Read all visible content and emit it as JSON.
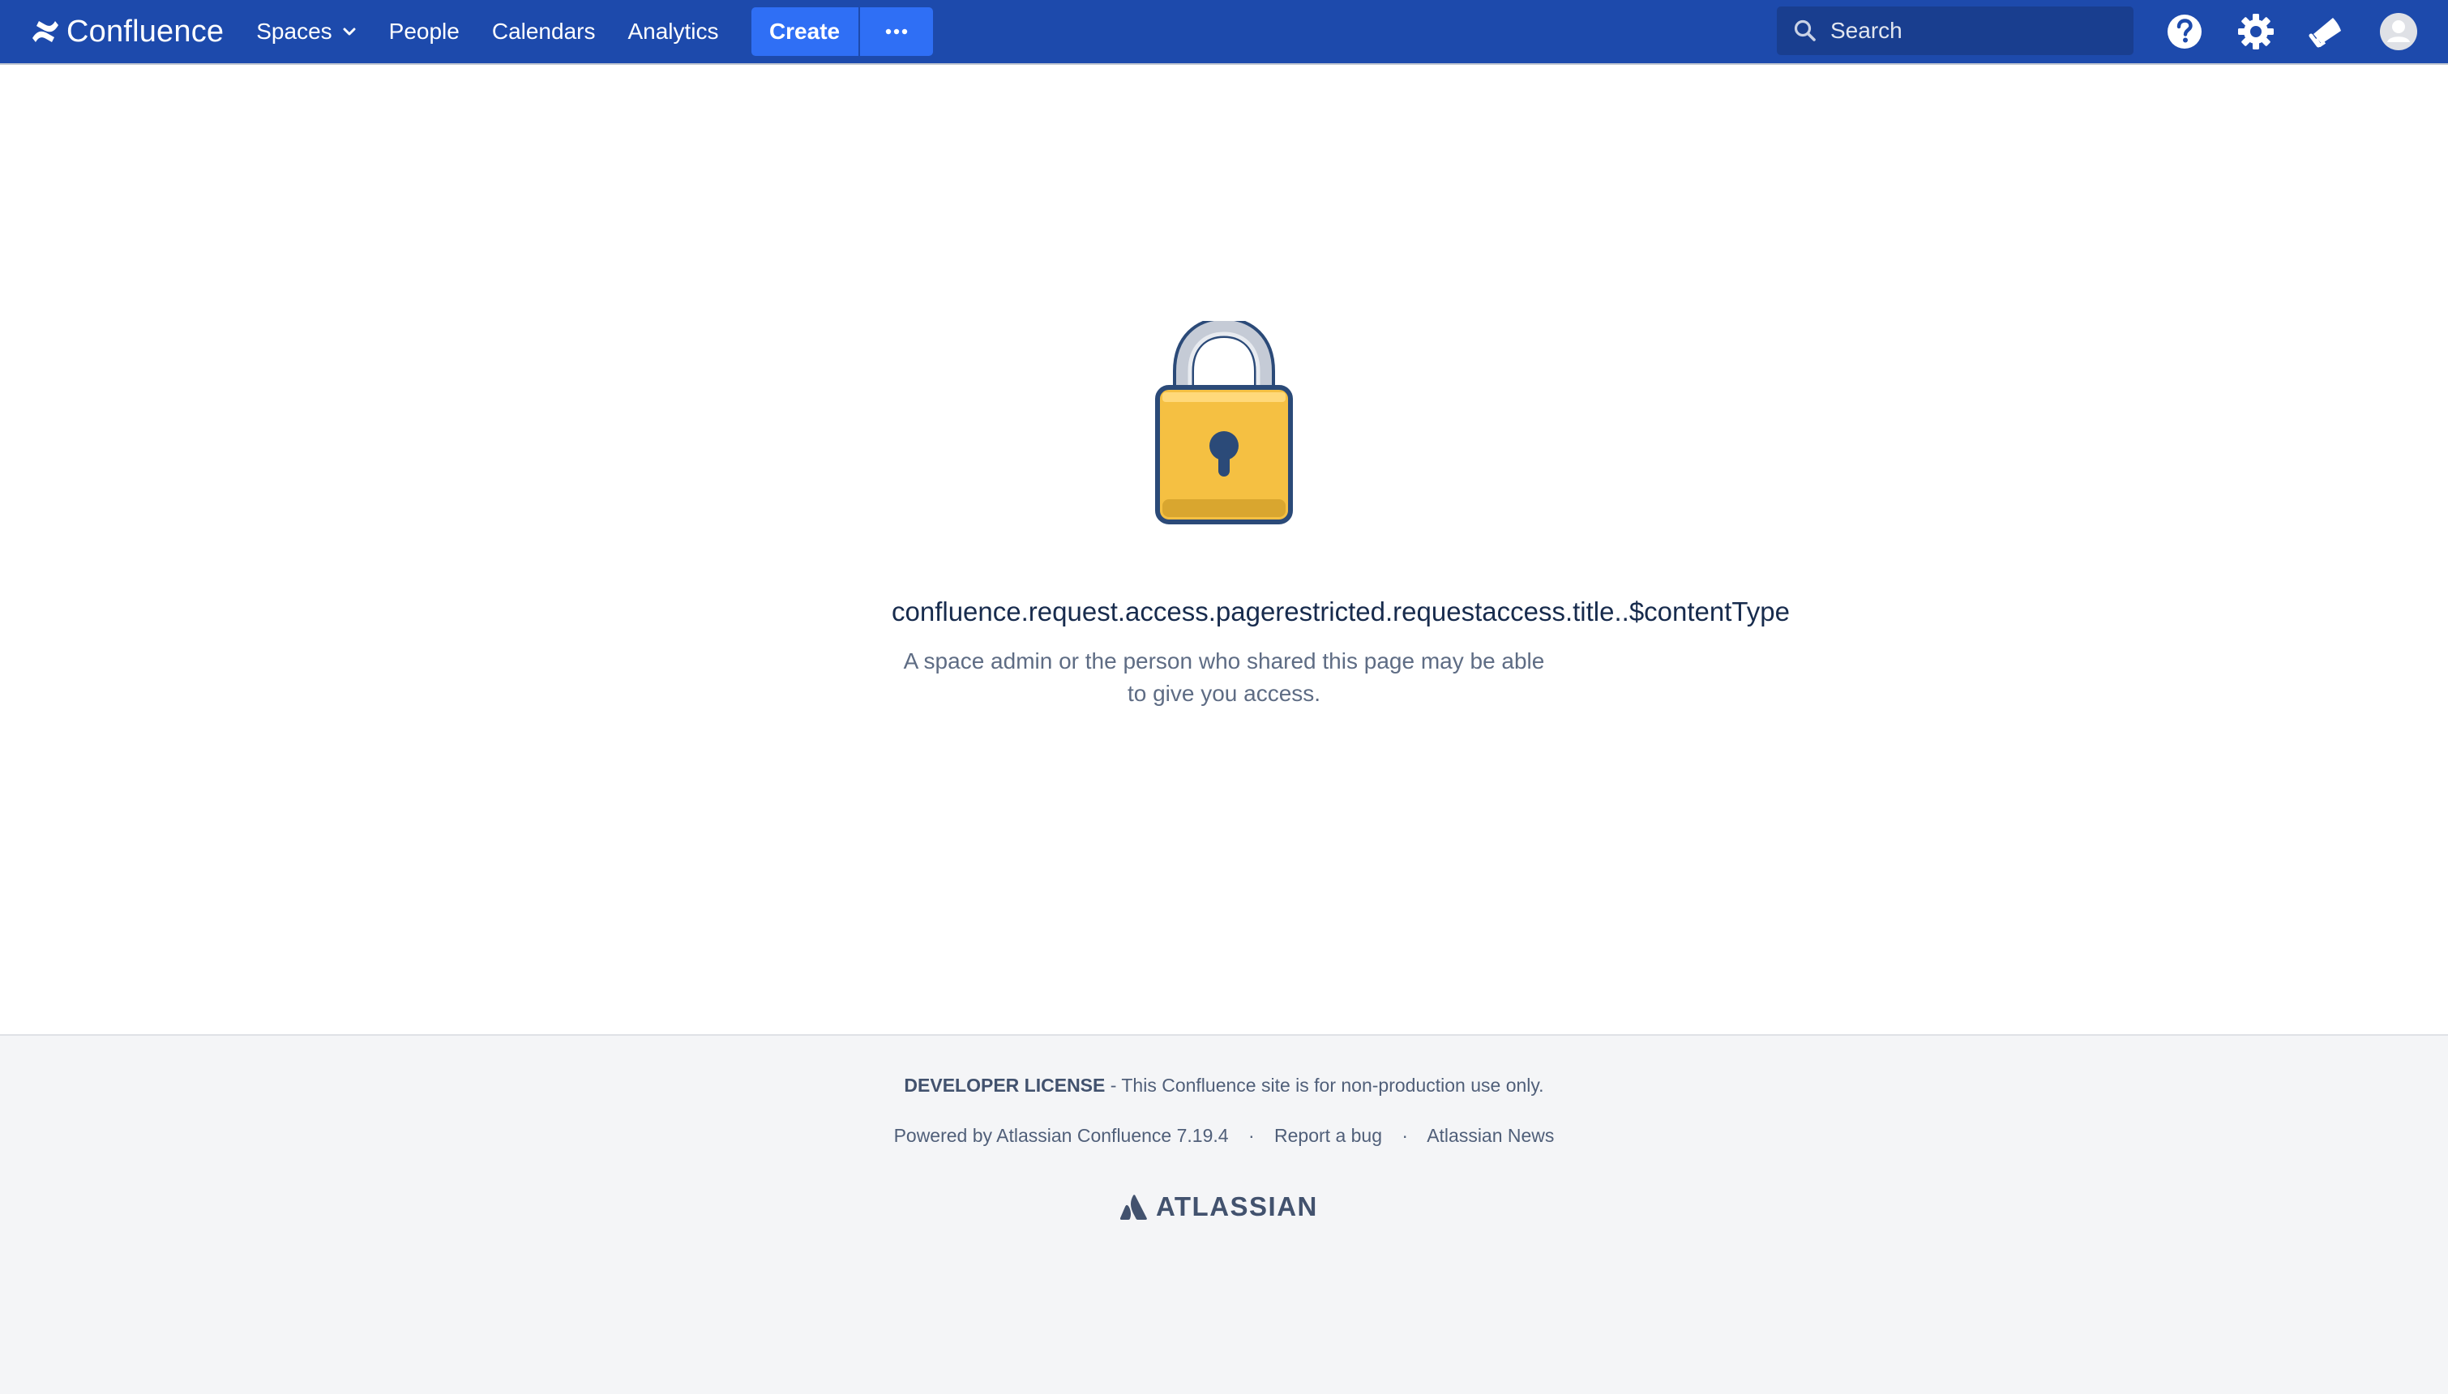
{
  "app": {
    "name": "Confluence"
  },
  "nav": {
    "items": [
      {
        "label": "Spaces",
        "has_dropdown": true
      },
      {
        "label": "People"
      },
      {
        "label": "Calendars"
      },
      {
        "label": "Analytics"
      }
    ],
    "create_label": "Create",
    "more_icon": "ellipsis-icon"
  },
  "search": {
    "placeholder": "Search"
  },
  "header_icons": [
    "help-icon",
    "gear-icon",
    "notification-megaphone-icon",
    "user-avatar-icon"
  ],
  "restriction": {
    "title": "confluence.request.access.pagerestricted.requestaccess.title..$contentType",
    "description": "A space admin or the person who shared this page may be able to give you access.",
    "icon": "padlock-icon"
  },
  "footer": {
    "license_label": "DEVELOPER LICENSE",
    "license_text": " - This Confluence site is for non-production use only.",
    "links": [
      "Powered by Atlassian Confluence 7.19.4",
      "Report a bug",
      "Atlassian News"
    ],
    "separator": "·",
    "brand": "ATLASSIAN"
  },
  "colors": {
    "header_bg": "#1d4aac",
    "create_bg": "#2f6ff5",
    "lock_body": "#f5c042",
    "lock_outline": "#2b4a78",
    "footer_bg": "#f4f5f7"
  }
}
